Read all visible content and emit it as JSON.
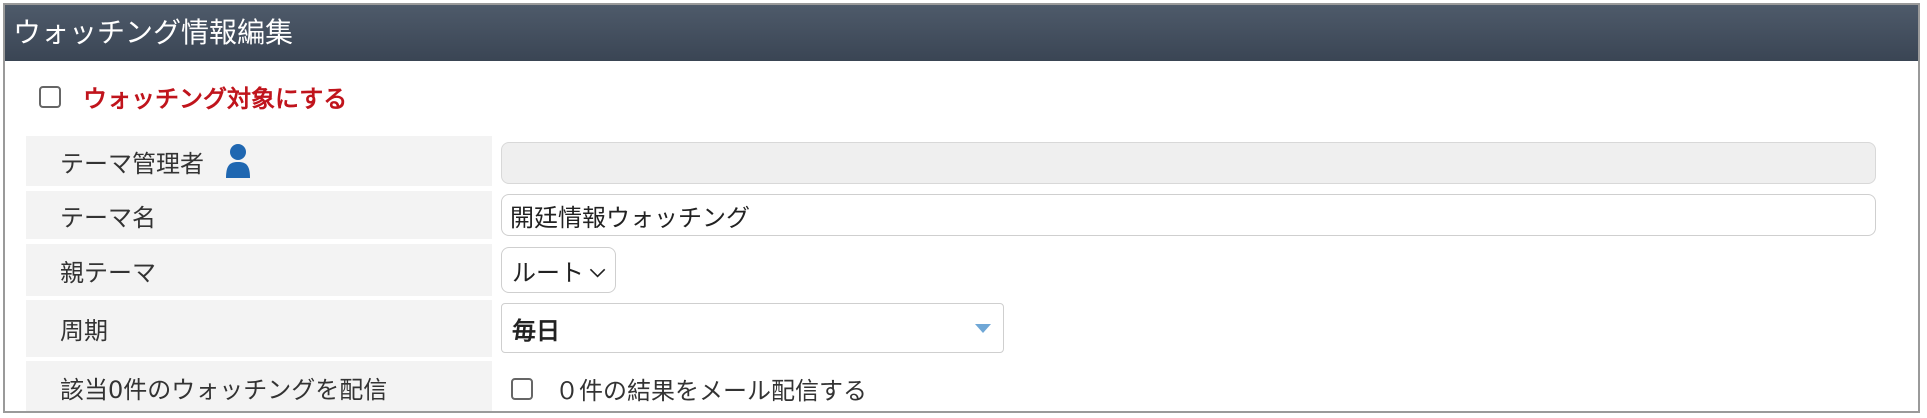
{
  "header": {
    "title": "ウォッチング情報編集"
  },
  "watch_toggle": {
    "label": "ウォッチング対象にする",
    "checked": false
  },
  "form": {
    "theme_admin": {
      "label": "テーマ管理者",
      "value": "",
      "disabled": true,
      "icon": "user-icon"
    },
    "theme_name": {
      "label": "テーマ名",
      "value": "開廷情報ウォッチング"
    },
    "parent_theme": {
      "label": "親テーマ",
      "selected": "ルート",
      "icon": "chevron-down-icon"
    },
    "period": {
      "label": "周期",
      "selected": "毎日",
      "icon": "dropdown-triangle-icon"
    },
    "zero_delivery": {
      "label": "該当0件のウォッチングを配信",
      "option_label": "０件の結果をメール配信する",
      "checked": false
    }
  },
  "colors": {
    "header_bg": "#3f4a59",
    "accent_red": "#c0141c",
    "label_bg": "#f3f3f3",
    "icon_blue": "#1f67b1"
  }
}
